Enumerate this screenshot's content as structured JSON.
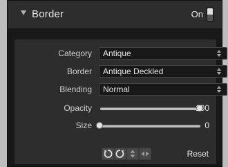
{
  "panel": {
    "title": "Border",
    "on_label": "On",
    "enabled": true
  },
  "fields": {
    "category_label": "Category",
    "category_value": "Antique",
    "border_label": "Border",
    "border_value": "Antique Deckled",
    "blending_label": "Blending",
    "blending_value": "Normal"
  },
  "sliders": {
    "opacity_label": "Opacity",
    "opacity_value": "100",
    "opacity_fraction": 1.0,
    "size_label": "Size",
    "size_value": "0",
    "size_fraction": 0.0
  },
  "tools": {
    "icons": [
      "rotate-left-icon",
      "rotate-right-icon",
      "flip-vertical-icon",
      "flip-horizontal-icon"
    ],
    "reset_label": "Reset"
  },
  "colors": {
    "panel_bg": "#2d2d2d",
    "frame_bg": "#181818",
    "text": "#e6e6e6"
  }
}
